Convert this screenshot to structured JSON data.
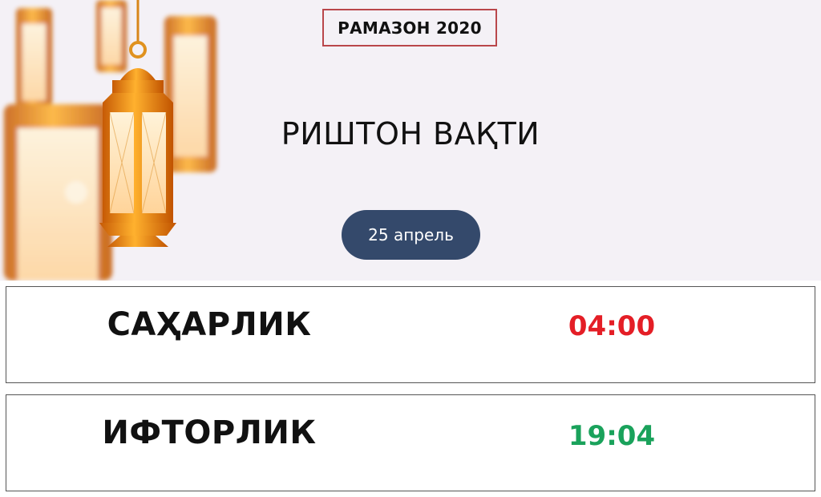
{
  "header": {
    "year_badge": "РАМАЗОН 2020",
    "city_title": "РИШТОН ВАҚТИ",
    "date": "25 апрель",
    "date_pill_color": "#34496b",
    "badge_border_color": "#b9474b"
  },
  "times": [
    {
      "label": "САҲАРЛИК",
      "time": "04:00",
      "color": "#e41e26"
    },
    {
      "label": "ИФТОРЛИК",
      "time": "19:04",
      "color": "#1aa25b"
    }
  ],
  "decor": {
    "image": "ramadan-lantern-icon"
  }
}
